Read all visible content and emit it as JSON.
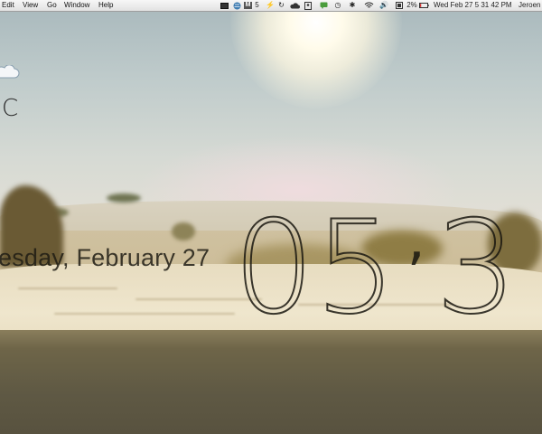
{
  "menubar": {
    "items": [
      "Edit",
      "View",
      "Go",
      "Window",
      "Help"
    ],
    "extras": {
      "m_badge": "M",
      "counter": "5",
      "battery_percent": "2%",
      "datetime": "Wed Feb 27  5 31 42 PM",
      "user": "Jeroen"
    }
  },
  "desktop": {
    "weather": {
      "unit": "C",
      "icon": "cloud-icon"
    },
    "date": "esday, February 27",
    "clock": {
      "hours": "05",
      "minutes_partial": "3"
    }
  },
  "colors": {
    "menubar_bg": "#eeeeee",
    "clock_stroke": "#19160f",
    "sky": "#bfcbcb",
    "sand": "#e7dcc0"
  }
}
